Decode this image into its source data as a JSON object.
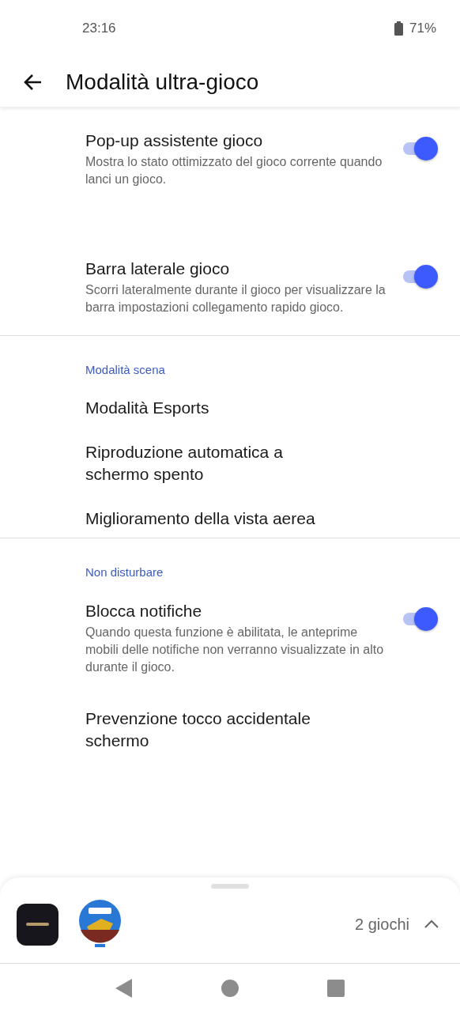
{
  "status_bar": {
    "time": "23:16",
    "battery": "71%"
  },
  "header": {
    "title": "Modalità ultra-gioco"
  },
  "sections": [
    {
      "items": [
        {
          "kind": "toggle",
          "title": "Pop-up assistente gioco",
          "description": "Mostra lo stato ottimizzato del gioco corrente quando lanci un gioco.",
          "on": true
        },
        {
          "kind": "toggle",
          "title": "Barra laterale gioco",
          "description": "Scorri lateralmente durante il gioco per visualizzare la barra impostazioni collegamento rapido gioco.",
          "on": true
        }
      ]
    },
    {
      "heading": "Modalità scena",
      "items": [
        {
          "kind": "plain",
          "title": "Modalità Esports"
        },
        {
          "kind": "plain",
          "title": "Riproduzione automatica a schermo spento"
        },
        {
          "kind": "plain",
          "title": "Miglioramento della vista aerea"
        }
      ]
    },
    {
      "heading": "Non disturbare",
      "items": [
        {
          "kind": "toggle",
          "title": "Blocca notifiche",
          "description": "Quando questa funzione è abilitata, le anteprime mobili delle notifiche non verranno visualizzate in alto durante il gioco.",
          "on": true
        },
        {
          "kind": "plain",
          "title": "Prevenzione tocco accidentale schermo"
        }
      ]
    }
  ],
  "games_sheet": {
    "apps": [
      {
        "kind": "dark"
      },
      {
        "kind": "racing"
      }
    ],
    "count": "2 giochi",
    "expanded": false
  }
}
